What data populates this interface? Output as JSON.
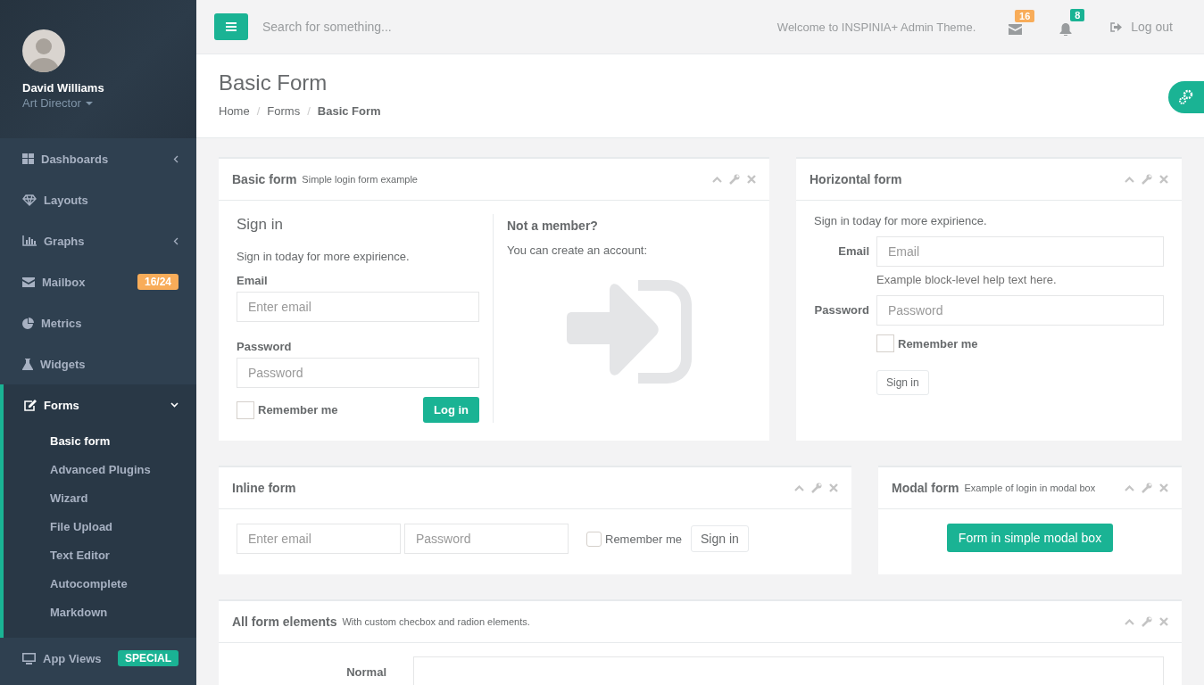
{
  "sidebar": {
    "profile": {
      "name": "David Williams",
      "role": "Art Director"
    },
    "items": [
      {
        "label": "Dashboards",
        "submenu": true,
        "expanded": false
      },
      {
        "label": "Layouts",
        "submenu": false,
        "expanded": false
      },
      {
        "label": "Graphs",
        "submenu": true,
        "expanded": false
      },
      {
        "label": "Mailbox",
        "submenu": false,
        "expanded": false,
        "badge": {
          "text": "16/24",
          "color": "#f8ac59"
        }
      },
      {
        "label": "Metrics",
        "submenu": false,
        "expanded": false
      },
      {
        "label": "Widgets",
        "submenu": false,
        "expanded": false
      },
      {
        "label": "Forms",
        "submenu": true,
        "expanded": true,
        "children": [
          {
            "label": "Basic form",
            "selected": true
          },
          {
            "label": "Advanced Plugins",
            "selected": false
          },
          {
            "label": "Wizard",
            "selected": false
          },
          {
            "label": "File Upload",
            "selected": false
          },
          {
            "label": "Text Editor",
            "selected": false
          },
          {
            "label": "Autocomplete",
            "selected": false
          },
          {
            "label": "Markdown",
            "selected": false
          }
        ]
      },
      {
        "label": "App Views",
        "submenu": false,
        "expanded": false,
        "badge": {
          "text": "SPECIAL",
          "color": "#1ab394"
        }
      }
    ]
  },
  "topbar": {
    "search": {
      "placeholder": "Search for something..."
    },
    "welcome": "Welcome to INSPINIA+ Admin Theme.",
    "notifications": [
      {
        "count": "16",
        "color": "#f8ac59"
      },
      {
        "count": "8",
        "color": "#1ab394"
      }
    ],
    "logout": "Log out"
  },
  "page_heading": {
    "title": "Basic Form",
    "separator": "/",
    "breadcrumbs": [
      {
        "label": "Home",
        "current": false
      },
      {
        "label": "Forms",
        "current": false
      },
      {
        "label": "Basic Form",
        "current": true
      }
    ]
  },
  "panels": [
    {
      "kind": "basic",
      "title": "Basic form",
      "subtitle": "Simple login form example",
      "heading": "Sign in",
      "text": "Sign in today for more expirience.",
      "fields": [
        {
          "label": "Email",
          "placeholder": "Enter email"
        },
        {
          "label": "Password",
          "placeholder": "Password"
        }
      ],
      "checkbox": {
        "label": "Remember me",
        "checked": false
      },
      "button": "Log in",
      "side_heading": "Not a member?",
      "side_text": "You can create an account:"
    },
    {
      "kind": "horizontal",
      "title": "Horizontal form",
      "text": "Sign in today for more expirience.",
      "fields": [
        {
          "label": "Email",
          "placeholder": "Email",
          "help": "Example block-level help text here."
        },
        {
          "label": "Password",
          "placeholder": "Password"
        }
      ],
      "checkbox": {
        "label": "Remember me",
        "checked": false
      },
      "button": "Sign in"
    },
    {
      "kind": "inline",
      "title": "Inline form",
      "fields": [
        {
          "placeholder": "Enter email"
        },
        {
          "placeholder": "Password"
        }
      ],
      "checkbox": {
        "label": "Remember me",
        "checked": false
      },
      "button": "Sign in"
    },
    {
      "kind": "modal",
      "title": "Modal form",
      "subtitle": "Example of login in modal box",
      "button": "Form in simple modal box"
    },
    {
      "kind": "elements",
      "title": "All form elements",
      "subtitle": "With custom checbox and radion elements.",
      "rows": [
        {
          "label": "Normal"
        }
      ]
    }
  ]
}
